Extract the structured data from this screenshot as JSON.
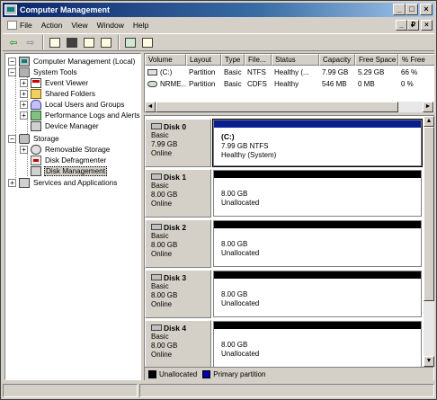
{
  "window": {
    "title": "Computer Management"
  },
  "menu": [
    {
      "label": "File"
    },
    {
      "label": "Action"
    },
    {
      "label": "View"
    },
    {
      "label": "Window"
    },
    {
      "label": "Help"
    }
  ],
  "title_buttons": {
    "minimize": "_",
    "restore": "□",
    "close": "×"
  },
  "mdi_buttons": {
    "minimize": "_",
    "restore": "₽",
    "close": "×"
  },
  "toolbar": {
    "icons": [
      "back-arrow-icon",
      "forward-arrow-icon",
      "up-folder-icon",
      "show-hide-tree-icon",
      "properties-icon",
      "refresh-icon",
      "help-icon",
      "export-icon"
    ]
  },
  "tree": {
    "items": [
      {
        "label": "Computer Management (Local)",
        "icon": "computer-icon",
        "expander": "−"
      },
      {
        "label": "System Tools",
        "icon": "tools-icon",
        "expander": "−"
      },
      {
        "label": "Event Viewer",
        "icon": "event-viewer-icon",
        "expander": "+"
      },
      {
        "label": "Shared Folders",
        "icon": "shared-folder-icon",
        "expander": "+"
      },
      {
        "label": "Local Users and Groups",
        "icon": "users-icon",
        "expander": "+"
      },
      {
        "label": "Performance Logs and Alerts",
        "icon": "performance-icon",
        "expander": "+"
      },
      {
        "label": "Device Manager",
        "icon": "device-manager-icon",
        "expander": ""
      },
      {
        "label": "Storage",
        "icon": "storage-icon",
        "expander": "−"
      },
      {
        "label": "Removable Storage",
        "icon": "removable-storage-icon",
        "expander": "+"
      },
      {
        "label": "Disk Defragmenter",
        "icon": "defragmenter-icon",
        "expander": ""
      },
      {
        "label": "Disk Management",
        "icon": "disk-management-icon",
        "expander": "",
        "selected": true
      },
      {
        "label": "Services and Applications",
        "icon": "services-icon",
        "expander": "+"
      }
    ]
  },
  "volume_list": {
    "columns": [
      "Volume",
      "Layout",
      "Type",
      "File...",
      "Status",
      "Capacity",
      "Free Space",
      "% Free"
    ],
    "rows": [
      {
        "volume": "(C:)",
        "layout": "Partition",
        "type": "Basic",
        "fs": "NTFS",
        "status": "Healthy (...",
        "capacity": "7.99 GB",
        "free": "5.29 GB",
        "pct": "66 %"
      },
      {
        "volume": "NRME...",
        "layout": "Partition",
        "type": "Basic",
        "fs": "CDFS",
        "status": "Healthy",
        "capacity": "546 MB",
        "free": "0 MB",
        "pct": "0 %"
      }
    ]
  },
  "disks": [
    {
      "name": "Disk 0",
      "type": "Basic",
      "size": "7.99 GB",
      "state": "Online",
      "partition": {
        "title": "(C:)",
        "line1": "7.99 GB NTFS",
        "line2": "Healthy (System)",
        "kind": "primary"
      }
    },
    {
      "name": "Disk 1",
      "type": "Basic",
      "size": "8.00 GB",
      "state": "Online",
      "partition": {
        "title": "",
        "line1": "8.00 GB",
        "line2": "Unallocated",
        "kind": "unallocated"
      }
    },
    {
      "name": "Disk 2",
      "type": "Basic",
      "size": "8.00 GB",
      "state": "Online",
      "partition": {
        "title": "",
        "line1": "8.00 GB",
        "line2": "Unallocated",
        "kind": "unallocated"
      }
    },
    {
      "name": "Disk 3",
      "type": "Basic",
      "size": "8.00 GB",
      "state": "Online",
      "partition": {
        "title": "",
        "line1": "8.00 GB",
        "line2": "Unallocated",
        "kind": "unallocated"
      }
    },
    {
      "name": "Disk 4",
      "type": "Basic",
      "size": "8.00 GB",
      "state": "Online",
      "partition": {
        "title": "",
        "line1": "8.00 GB",
        "line2": "Unallocated",
        "kind": "unallocated"
      }
    }
  ],
  "legend": [
    {
      "label": "Unallocated",
      "color": "#000000"
    },
    {
      "label": "Primary partition",
      "color": "#0000a8"
    }
  ],
  "colors": {
    "primary_bar": "#0a1f8f",
    "unallocated_bar": "#000000"
  }
}
